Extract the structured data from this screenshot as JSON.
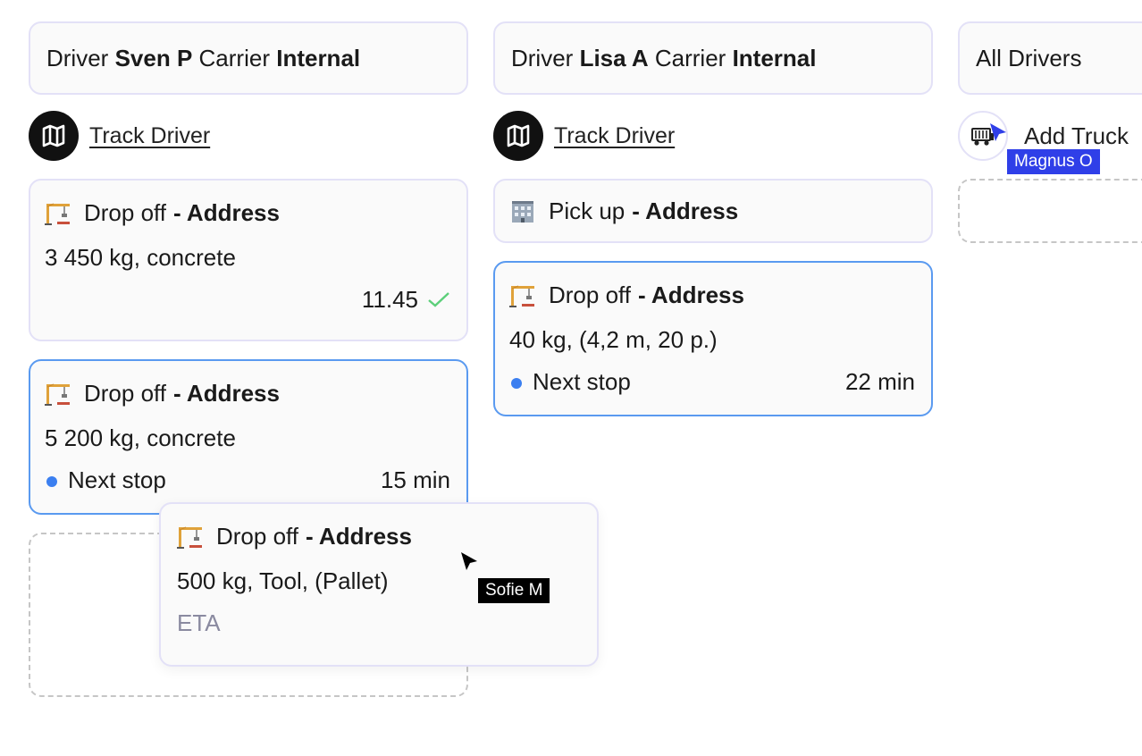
{
  "columns": [
    {
      "header": {
        "driver_label": "Driver",
        "driver_name": "Sven P",
        "carrier_label": "Carrier",
        "carrier_name": "Internal"
      },
      "action": {
        "label": "Track Driver",
        "icon": "map-icon"
      },
      "cards": [
        {
          "type_label": "Drop off",
          "address_label": "- Address",
          "icon": "crane-icon",
          "load": "3 450 kg, concrete",
          "time": "11.45",
          "status": "completed"
        },
        {
          "type_label": "Drop off",
          "address_label": "- Address",
          "icon": "crane-icon",
          "load": "5 200 kg, concrete",
          "next_label": "Next stop",
          "eta": "15 min",
          "status": "next"
        }
      ]
    },
    {
      "header": {
        "driver_label": "Driver",
        "driver_name": "Lisa A",
        "carrier_label": "Carrier",
        "carrier_name": "Internal"
      },
      "action": {
        "label": "Track Driver",
        "icon": "map-icon"
      },
      "pickup": {
        "type_label": "Pick up",
        "address_label": "- Address",
        "icon": "building-icon"
      },
      "cards": [
        {
          "type_label": "Drop off",
          "address_label": "- Address",
          "icon": "crane-icon",
          "load": "40 kg, (4,2 m, 20 p.)",
          "next_label": "Next stop",
          "eta": "22 min",
          "status": "next"
        }
      ]
    },
    {
      "header": {
        "title": "All Drivers"
      },
      "action": {
        "label": "Add Truck",
        "icon": "truck-icon"
      }
    }
  ],
  "dragging_card": {
    "type_label": "Drop off",
    "address_label": "- Address",
    "icon": "crane-icon",
    "load": "500 kg, Tool, (Pallet)",
    "eta_label": "ETA"
  },
  "cursors": [
    {
      "user": "Sofie M",
      "color": "#000000"
    },
    {
      "user": "Magnus O",
      "color": "#2f3fe8"
    }
  ],
  "colors": {
    "accent_border": "#5a9af0",
    "card_border": "#e3e1f7",
    "next_dot": "#3b7ff0",
    "check": "#5ccf7a",
    "muted": "#8a8aa0"
  }
}
